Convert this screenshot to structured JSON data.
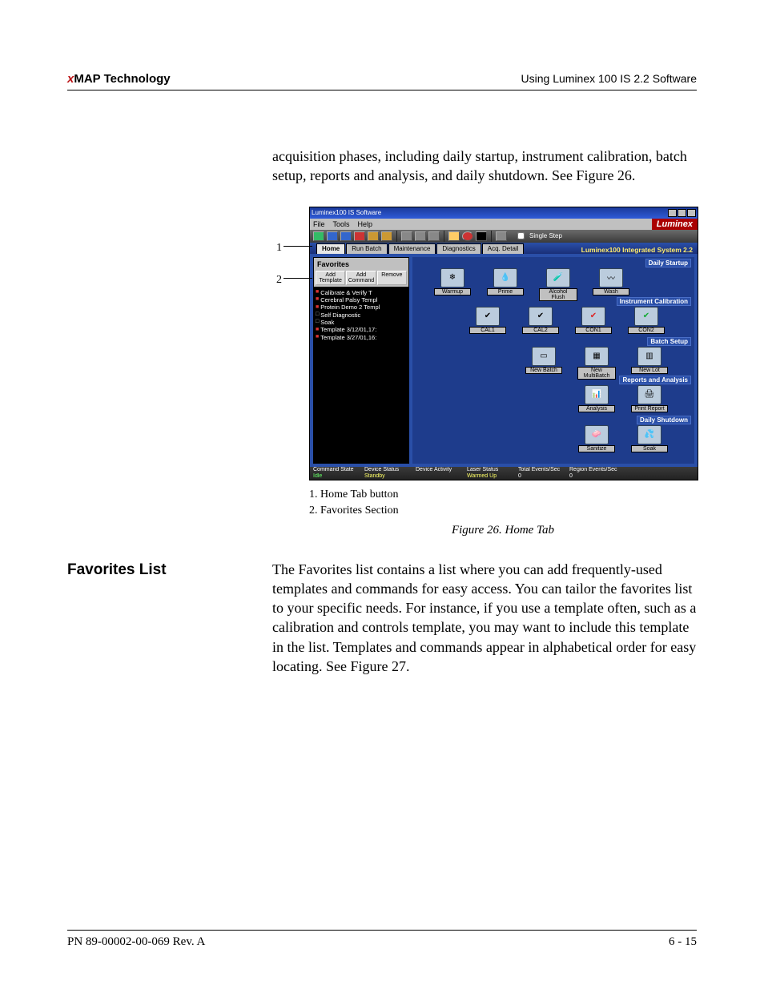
{
  "header": {
    "left_prefix": "x",
    "left_main": "MAP Technology",
    "right": "Using Luminex 100 IS 2.2 Software"
  },
  "intro": "acquisition phases, including daily startup, instrument calibration, batch setup, reports and analysis, and daily shutdown. See Figure 26.",
  "callouts": {
    "one": "1",
    "two": "2"
  },
  "app": {
    "title": "Luminex100 IS Software",
    "menu": {
      "file": "File",
      "tools": "Tools",
      "help": "Help"
    },
    "brand": "Luminex",
    "single_step": "Single Step",
    "tabs": {
      "home": "Home",
      "run": "Run Batch",
      "maint": "Maintenance",
      "diag": "Diagnostics",
      "acq": "Acq. Detail"
    },
    "system_version": "Luminex100 Integrated System 2.2",
    "favorites": {
      "title": "Favorites",
      "add_template": "Add Template",
      "add_command": "Add Command",
      "remove": "Remove",
      "items": [
        "Calibrate & Verify T",
        "Cerebral Palsy Templ",
        "Protein Demo 2 Templ",
        "Self Diagnostic",
        "Soak",
        "Template 3/12/01,17:",
        "Template 3/27/01,16:"
      ]
    },
    "groups": {
      "daily_startup": {
        "label": "Daily Startup",
        "ops": [
          "Warmup",
          "Prime",
          "Alcohol Flush",
          "Wash"
        ]
      },
      "instrument_cal": {
        "label": "Instrument Calibration",
        "ops": [
          "CAL1",
          "CAL2",
          "CON1",
          "CON2"
        ]
      },
      "batch_setup": {
        "label": "Batch Setup",
        "ops": [
          "New Batch",
          "New MultiBatch",
          "New Lot"
        ]
      },
      "reports": {
        "label": "Reports and Analysis",
        "ops": [
          "Analysis",
          "Print Report"
        ]
      },
      "daily_shutdown": {
        "label": "Daily Shutdown",
        "ops": [
          "Sanitize",
          "Soak"
        ]
      }
    },
    "status_labels": {
      "cmd": "Command State",
      "dev": "Device Status",
      "act": "Device Activity",
      "laser": "Laser Status",
      "total": "Total Events/Sec",
      "region": "Region Events/Sec"
    },
    "status_values": {
      "cmd": "Idle",
      "dev": "Standby",
      "act": "",
      "laser": "Warmed Up",
      "total": "0",
      "region": "0"
    }
  },
  "legend": {
    "l1": "1. Home Tab button",
    "l2": "2. Favorites Section"
  },
  "figure_caption": "Figure 26.  Home Tab",
  "section": {
    "heading": "Favorites List",
    "body": "The Favorites list contains a list where you can add frequently-used templates and commands for easy access. You can tailor the favorites list to your specific needs. For instance, if you use a template often, such as a calibration and controls template, you may want to include this template in the list. Templates and commands appear in alphabetical order for easy locating. See Figure 27."
  },
  "footer": {
    "left": "PN 89-00002-00-069 Rev. A",
    "right": "6 - 15"
  }
}
